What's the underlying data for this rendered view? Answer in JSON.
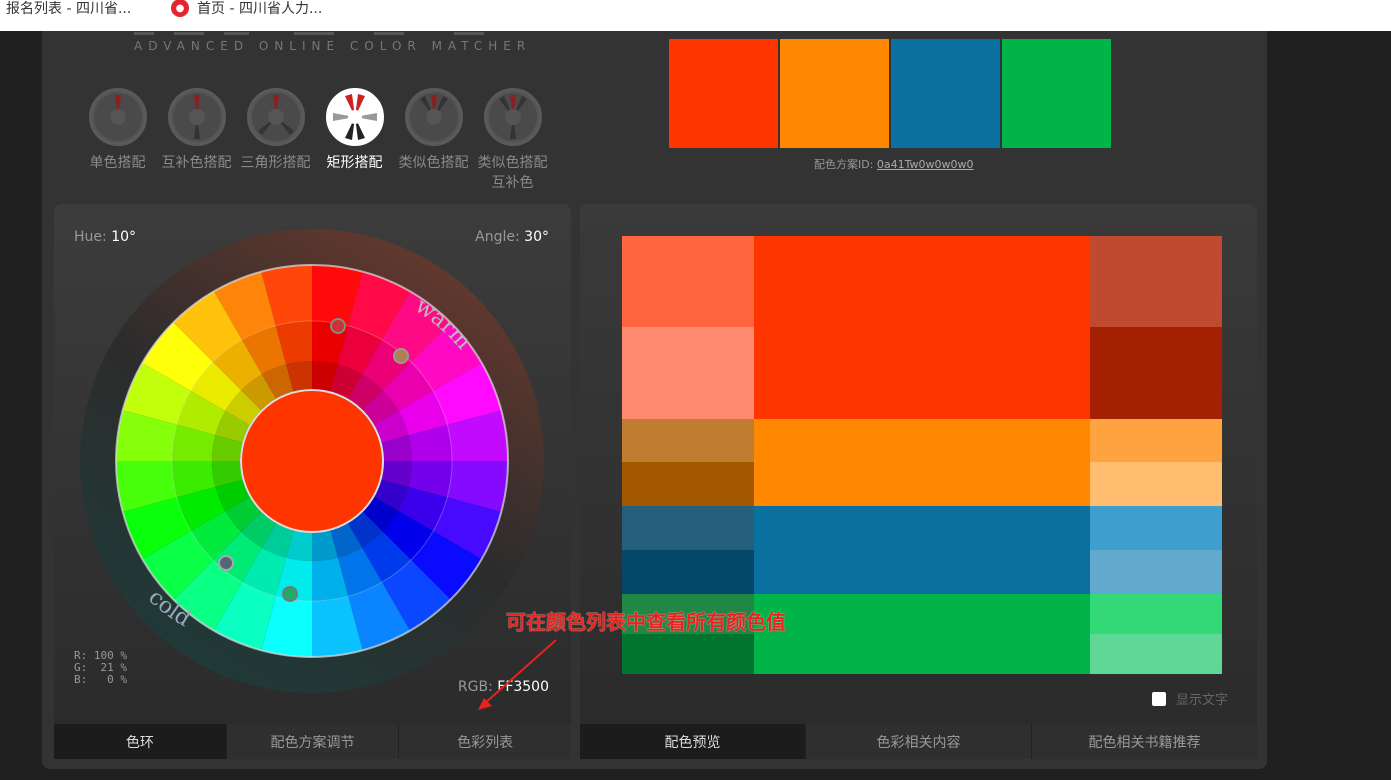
{
  "bookmarks": [
    {
      "label": "报名列表 - 四川省..."
    },
    {
      "label": "首页 - 四川省人力..."
    }
  ],
  "logo_subtitle": "ADVANCED ONLINE COLOR MATCHER",
  "modes": [
    {
      "label": "单色搭配"
    },
    {
      "label": "互补色搭配"
    },
    {
      "label": "三角形搭配"
    },
    {
      "label": "矩形搭配"
    },
    {
      "label": "类似色搭配"
    },
    {
      "label": "类似色搭配互补色"
    }
  ],
  "palette": {
    "swatches": [
      "#FF3500",
      "#FF8800",
      "#0A70A0",
      "#00B449"
    ],
    "scheme_id_label": "配色方案ID:",
    "scheme_id": "0a41Tw0w0w0w0"
  },
  "wheel_panel": {
    "hue_label": "Hue:",
    "hue_value": "10°",
    "angle_label": "Angle:",
    "angle_value": "30°",
    "warm_label": "warm",
    "cold_label": "cold",
    "rgb_percent": "R: 100 %\nG:  21 %\nB:   0 %",
    "rgb_label": "RGB:",
    "rgb_value": "FF3500",
    "center_color": "#FF3500",
    "tabs": [
      {
        "label": "色环",
        "active": true
      },
      {
        "label": "配色方案调节",
        "active": false
      },
      {
        "label": "色彩列表",
        "active": false
      }
    ]
  },
  "preview_panel": {
    "show_text_label": "显示文字",
    "tabs": [
      {
        "label": "配色预览",
        "active": true
      },
      {
        "label": "色彩相关内容",
        "active": false
      },
      {
        "label": "配色相关书籍推荐",
        "active": false
      }
    ],
    "colors": {
      "red_main": "#FF3500",
      "red_light1": "#FF6640",
      "red_light2": "#FF8A70",
      "red_dark1": "#C04A30",
      "red_dark2": "#A32000",
      "orange_main": "#FF8800",
      "orange_dark1": "#C07C30",
      "orange_dark2": "#A35800",
      "orange_light1": "#FFA340",
      "orange_light2": "#FFBD70",
      "blue_main": "#0A70A0",
      "blue_dark1": "#255F7C",
      "blue_dark2": "#034769",
      "blue_light1": "#3D9FCD",
      "blue_light2": "#62AACD",
      "green_main": "#00B449",
      "green_dark1": "#218747",
      "green_dark2": "#00752F",
      "green_light1": "#33D877",
      "green_light2": "#5FD895"
    }
  },
  "annotation": {
    "text": "可在颜色列表中查看所有颜色值",
    "color": "#E8231E"
  }
}
